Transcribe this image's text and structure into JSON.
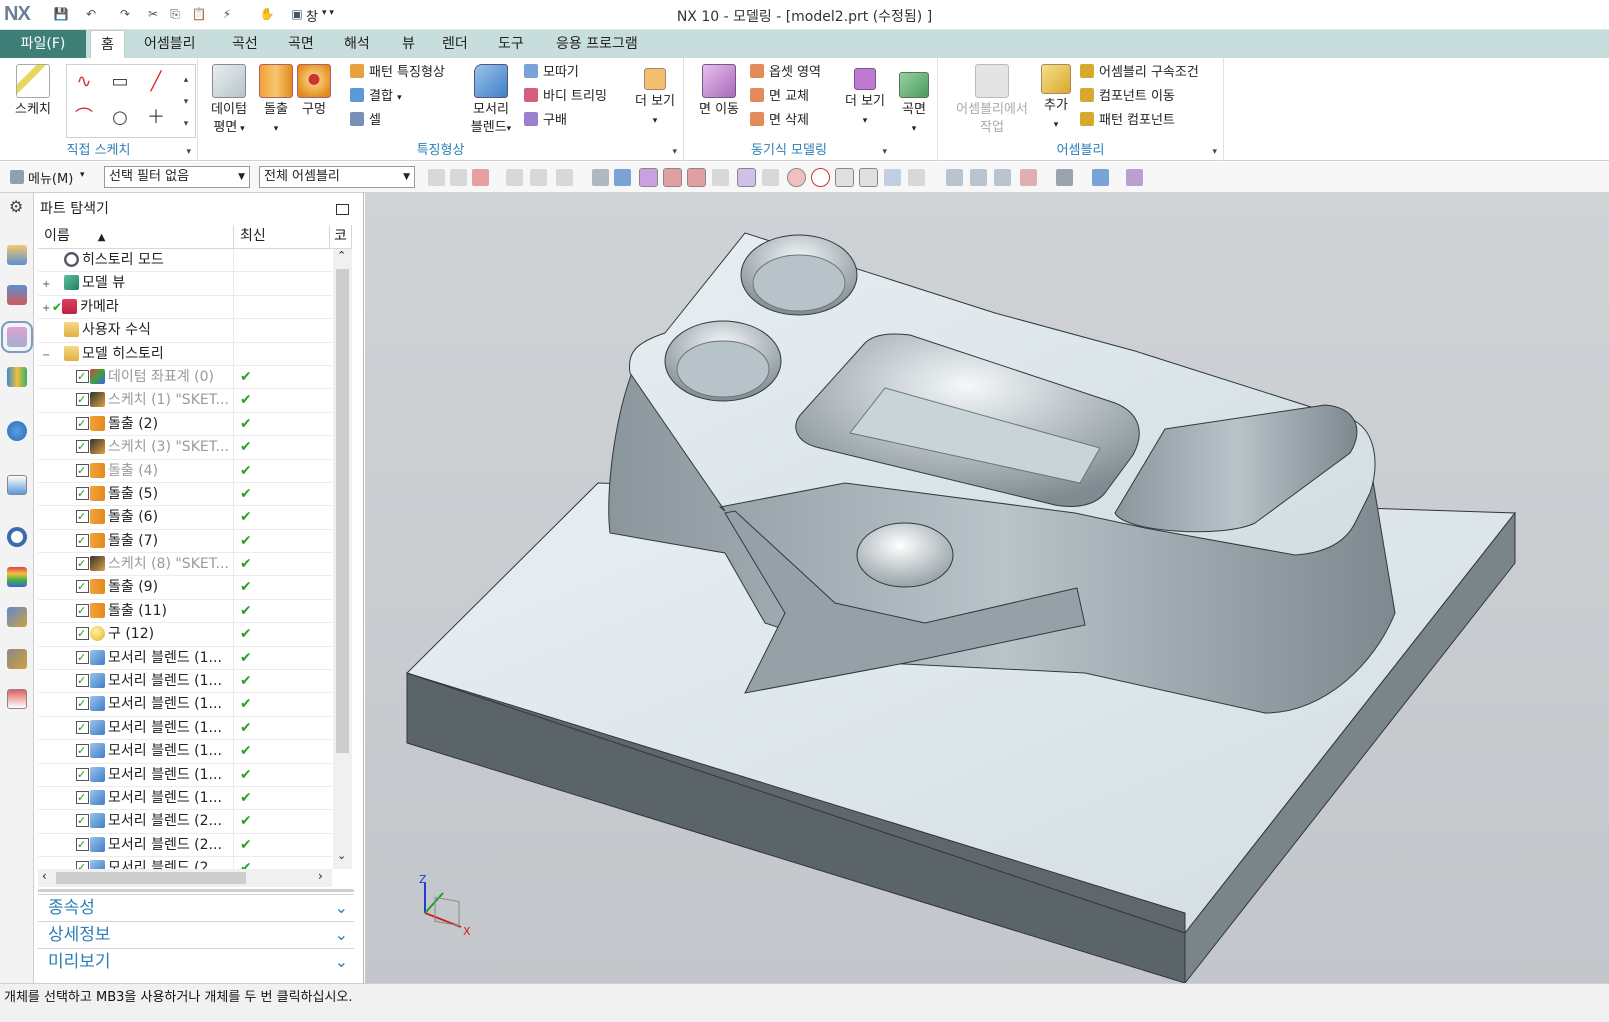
{
  "titlebar": {
    "logo": "NX",
    "window_title": "NX 10 - 모델링 - [model2.prt (수정됨) ]",
    "window_menu": "창"
  },
  "menu_tabs": {
    "file": "파일(F)",
    "tabs": [
      "홈",
      "어셈블리",
      "곡선",
      "곡면",
      "해석",
      "뷰",
      "렌더",
      "도구",
      "응용 프로그램"
    ]
  },
  "ribbon": {
    "sketch": "스케치",
    "group_direct_sketch": "직접 스케치",
    "datum_plane_1": "데이텀",
    "datum_plane_2": "평면",
    "extrude": "돌출",
    "hole": "구멍",
    "pattern_feature": "패턴 특징형상",
    "unite": "결합",
    "shell": "셀",
    "edge_blend_1": "모서리",
    "edge_blend_2": "블렌드",
    "chamfer": "모따기",
    "trim_body": "바디 트리밍",
    "draft": "구배",
    "more1": "더 보기",
    "group_feature": "특징형상",
    "move_face": "면 이동",
    "offset_region": "옵셋 영역",
    "replace_face": "면 교체",
    "delete_face": "면 삭제",
    "more2": "더 보기",
    "group_sync": "동기식 모델링",
    "surface": "곡면",
    "work_in_assembly_1": "어셈블리에서",
    "work_in_assembly_2": "작업",
    "add": "추가",
    "assembly_constraints": "어셈블리 구속조건",
    "move_component": "컴포넌트 이동",
    "pattern_component": "패턴 컴포넌트",
    "group_assembly": "어셈블리"
  },
  "toolbar2": {
    "menu": "메뉴(M)",
    "selection_filter": "선택 필터 없음",
    "scope": "전체 어셈블리"
  },
  "navigator": {
    "title": "파트 탐색기",
    "col_name": "이름",
    "col_latest": "최신",
    "col_comment": "코",
    "rows": [
      {
        "label": "히스토리 모드",
        "indent": 1,
        "icon": "clock-icon",
        "check": false,
        "latest": "",
        "dim": false,
        "toggle": ""
      },
      {
        "label": "모델 뷰",
        "indent": 1,
        "icon": "model-view-icon",
        "check": false,
        "latest": "",
        "dim": false,
        "toggle": "+"
      },
      {
        "label": "카메라",
        "indent": 1,
        "icon": "camera-icon",
        "check": false,
        "latest": "",
        "dim": false,
        "toggle": "+",
        "tick": true
      },
      {
        "label": "사용자 수식",
        "indent": 1,
        "icon": "folder-icon",
        "check": false,
        "latest": "",
        "dim": false,
        "toggle": ""
      },
      {
        "label": "모델 히스토리",
        "indent": 1,
        "icon": "folder-open-icon",
        "check": false,
        "latest": "",
        "dim": false,
        "toggle": "−"
      },
      {
        "label": "데이텀 좌표계 (0)",
        "indent": 2,
        "icon": "datum-csys-icon",
        "check": true,
        "latest": "✔",
        "dim": true
      },
      {
        "label": "스케치 (1) \"SKET...",
        "indent": 2,
        "icon": "sketch-icon",
        "check": true,
        "latest": "✔",
        "dim": true
      },
      {
        "label": "돌출 (2)",
        "indent": 2,
        "icon": "extrude-icon",
        "check": true,
        "latest": "✔",
        "dim": false
      },
      {
        "label": "스케치 (3) \"SKET...",
        "indent": 2,
        "icon": "sketch-icon",
        "check": true,
        "latest": "✔",
        "dim": true
      },
      {
        "label": "돌출 (4)",
        "indent": 2,
        "icon": "extrude-icon",
        "check": true,
        "latest": "✔",
        "dim": true
      },
      {
        "label": "돌출 (5)",
        "indent": 2,
        "icon": "extrude-icon",
        "check": true,
        "latest": "✔",
        "dim": false
      },
      {
        "label": "돌출 (6)",
        "indent": 2,
        "icon": "extrude-icon",
        "check": true,
        "latest": "✔",
        "dim": false
      },
      {
        "label": "돌출 (7)",
        "indent": 2,
        "icon": "extrude-icon",
        "check": true,
        "latest": "✔",
        "dim": false
      },
      {
        "label": "스케치 (8) \"SKET...",
        "indent": 2,
        "icon": "sketch-icon",
        "check": true,
        "latest": "✔",
        "dim": true
      },
      {
        "label": "돌출 (9)",
        "indent": 2,
        "icon": "extrude-icon",
        "check": true,
        "latest": "✔",
        "dim": false
      },
      {
        "label": "돌출 (11)",
        "indent": 2,
        "icon": "extrude-icon",
        "check": true,
        "latest": "✔",
        "dim": false
      },
      {
        "label": "구 (12)",
        "indent": 2,
        "icon": "sphere-icon",
        "check": true,
        "latest": "✔",
        "dim": false
      },
      {
        "label": "모서리 블렌드 (1...",
        "indent": 2,
        "icon": "edge-blend-icon",
        "check": true,
        "latest": "✔",
        "dim": false
      },
      {
        "label": "모서리 블렌드 (1...",
        "indent": 2,
        "icon": "edge-blend-icon",
        "check": true,
        "latest": "✔",
        "dim": false
      },
      {
        "label": "모서리 블렌드 (1...",
        "indent": 2,
        "icon": "edge-blend-icon",
        "check": true,
        "latest": "✔",
        "dim": false
      },
      {
        "label": "모서리 블렌드 (1...",
        "indent": 2,
        "icon": "edge-blend-icon",
        "check": true,
        "latest": "✔",
        "dim": false
      },
      {
        "label": "모서리 블렌드 (1...",
        "indent": 2,
        "icon": "edge-blend-icon",
        "check": true,
        "latest": "✔",
        "dim": false
      },
      {
        "label": "모서리 블렌드 (1...",
        "indent": 2,
        "icon": "edge-blend-icon",
        "check": true,
        "latest": "✔",
        "dim": false
      },
      {
        "label": "모서리 블렌드 (1...",
        "indent": 2,
        "icon": "edge-blend-icon",
        "check": true,
        "latest": "✔",
        "dim": false
      },
      {
        "label": "모서리 블렌드 (2...",
        "indent": 2,
        "icon": "edge-blend-icon",
        "check": true,
        "latest": "✔",
        "dim": false
      },
      {
        "label": "모서리 블렌드 (2...",
        "indent": 2,
        "icon": "edge-blend-icon",
        "check": true,
        "latest": "✔",
        "dim": false
      },
      {
        "label": "모서리 블렌드 (2...",
        "indent": 2,
        "icon": "edge-blend-icon",
        "check": true,
        "latest": "✔",
        "dim": false
      }
    ]
  },
  "panels": {
    "dependencies": "종속성",
    "details": "상세정보",
    "preview": "미리보기"
  },
  "viewport": {
    "axis_x": "X",
    "axis_z": "Z"
  },
  "status_text": "개체를 선택하고 MB3을 사용하거나 개체를 두 번 클릭하십시오.",
  "colors": {
    "accent": "#2a7fb8",
    "file_tab": "#3d7f77",
    "tab_bar": "#c8dedc",
    "check": "#2aa02a",
    "part_top": "#dde6ea",
    "part_side": "#5b6469"
  }
}
